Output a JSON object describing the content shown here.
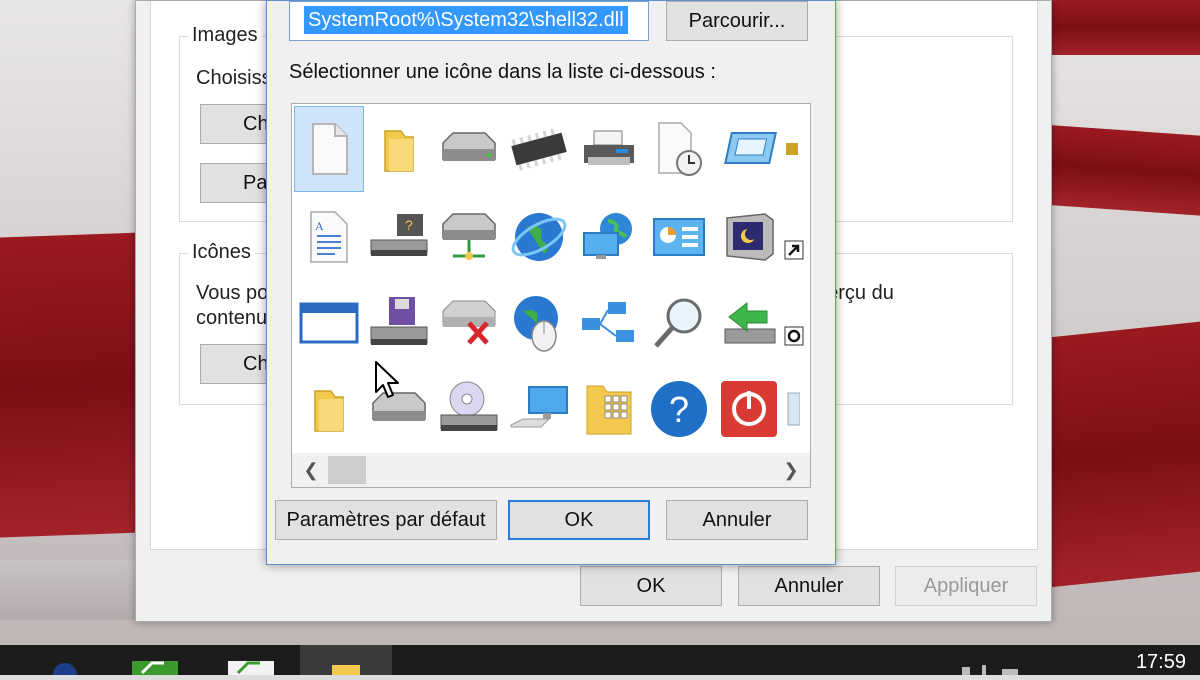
{
  "background_window": {
    "group_images_title": "Images",
    "group_images_text": "Choisiss",
    "btn_choose_1": "Ch",
    "btn_params": "Para",
    "group_icons_title": "Icônes",
    "group_icons_text_1": "Vous po",
    "group_icons_text_2": "contenu",
    "group_icons_text_right": "perçu du",
    "btn_choose_2": "Ch",
    "ok": "OK",
    "cancel": "Annuler",
    "apply": "Appliquer"
  },
  "icon_dialog": {
    "path_value": "SystemRoot%\\System32\\shell32.dll",
    "browse": "Parcourir...",
    "list_label": "Sélectionner une icône dans la liste ci-dessous :",
    "icons": [
      "blank-document",
      "folder",
      "hard-drive",
      "memory-chip",
      "printer",
      "clock-document",
      "display-screen",
      "partial-icon",
      "text-document",
      "network-drive",
      "network-server",
      "internet-globe",
      "network-computer",
      "control-panel",
      "screensaver-monitor",
      "shortcut-arrow",
      "application-window",
      "floppy-drive",
      "disconnected-drive",
      "globe-mouse",
      "network-connections",
      "magnifier",
      "removable-drive",
      "overlay-badge",
      "folder",
      "optical-drive",
      "cd-drive",
      "desktop-computer",
      "folder-grid",
      "help",
      "power-button",
      "recycle-bin-partial"
    ],
    "selected_index": 0,
    "btn_defaults": "Paramètres par défaut",
    "btn_ok": "OK",
    "btn_cancel": "Annuler"
  },
  "taskbar": {
    "clock": "17:59"
  },
  "colors": {
    "selection": "#3399ff",
    "accent_border": "#2a7fd4",
    "flag_red": "#9a1a20"
  }
}
